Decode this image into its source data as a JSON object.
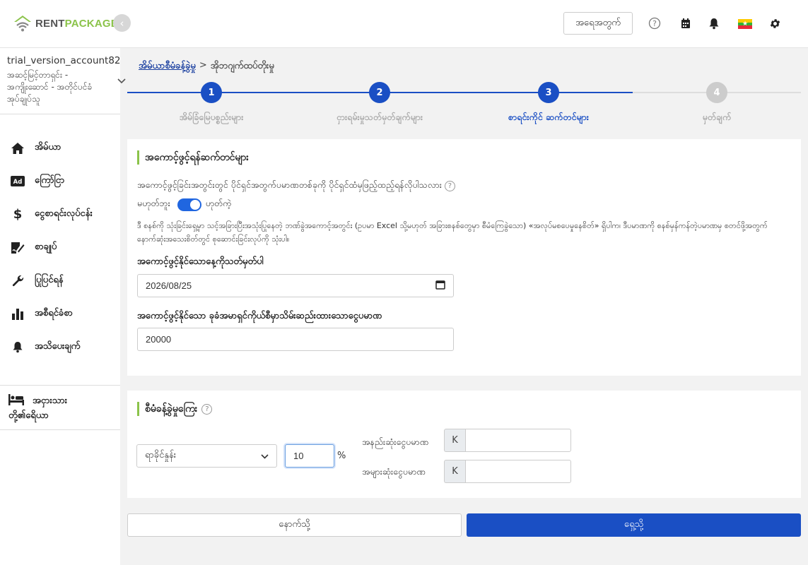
{
  "app": {
    "logo_rent": "RENT",
    "logo_package": "PACKAGE"
  },
  "header": {
    "search_label": "အရေအတွက်"
  },
  "account": {
    "name": "trial_version_account82",
    "plan": "အဆင့်မြင့်တာရှင်း - အကျိုးဆောင် - အတိုင်ပင်ခံ အုပ်ချုပ်သူ"
  },
  "sidebar": {
    "items": [
      {
        "label": "အိမ်ယာ",
        "icon": "home-icon"
      },
      {
        "label": "ကြော်ငြာ",
        "icon": "ad-icon"
      },
      {
        "label": "ငွေစာရင်းလုပ်ငန်း",
        "icon": "dollar-icon"
      },
      {
        "label": "စာချုပ်",
        "icon": "contract-icon"
      },
      {
        "label": "ပြုပြင်ရန်",
        "icon": "wrench-icon"
      },
      {
        "label": "အစီရင်ခံစာ",
        "icon": "bar-chart-icon"
      },
      {
        "label": "အသိပေးချက်",
        "icon": "bell-icon"
      }
    ],
    "footer_line1": "အငှားသား",
    "footer_line2": "တို့၏ရေိယာ"
  },
  "breadcrumb": {
    "home": "အိမ်ယာစီမံခန့်ခွဲမှု",
    "separator": ">",
    "current": "အိုဘဂျက်ထပ်တိုးမှု"
  },
  "stepper": {
    "steps": [
      {
        "number": "1",
        "label": "အိမ်ခြံမြေပစ္စည်းများ",
        "state": "done"
      },
      {
        "number": "2",
        "label": "ငှားရမ်းမှုသတ်မှတ်ချက်များ",
        "state": "done"
      },
      {
        "number": "3",
        "label": "စာရင်းကိုင် ဆက်တင်များ",
        "state": "active"
      },
      {
        "number": "4",
        "label": "မှတ်ချက်",
        "state": "pending"
      }
    ],
    "colors": {
      "active": "#1a4fc4",
      "done_label": "#aaaaaa",
      "pending": "#cccccc"
    }
  },
  "renewal": {
    "title": "အကောင့်ဖွင့်ရန်ဆက်တင်များ",
    "question": "အကောင့်ဖွင့်ခြင်းအတွင်းတွင် ပိုင်ရှင်အတွက်ပမာဏတစ်ခုကို ပိုင်ရှင်ထံမှဖြည့်ထည့်ရန်လိုပါသလား",
    "toggle_off": "မဟုတ်ဘူး",
    "toggle_on": "ဟုတ်ကဲ့",
    "toggle_state": "on",
    "note": "ဒီ စနစ်ကို သုံးခြင်းရှေ့မှာ သင့်အခြားပြီးအသုံးပြုနေတဲ့ ဘဏ်ခွဲအကောင့်အတွင်း (ဥပမာ Excel သို့မဟုတ် အခြားစနစ်တွေမှာ စီမံကြေခွဲသော) «အလုပ်မစပေမှုနေစိတ်» ရှိပါက၊ ဒီပမာဏကို စနစ်မှန်ကန်တဲ့ပမာဏမှ စတင်ဖို့အတွက် နောက်ဆုံးအသေးစိတ်တွင် စုဆောင်းခြင်းလုပ်ကို သုံးပါ။",
    "date_label": "အကောင့်ဖွင့်နိုင်သောနေ့ကိုသတ်မှတ်ပါ",
    "date_value": "2026/08/25",
    "amount_label": "အကောင့်ဖွင့်နိုင်သော ခုခံအမာရှင်ကိုယ်စီမှာသိမ်းဆည်းထားသောငွေပမာဏ",
    "amount_value": "20000"
  },
  "management": {
    "title": "စီမံခန့်ခွဲမှုကြေး",
    "select_value": "ရာခိုင်နှုန်း",
    "percent_value": "10",
    "percent_sign": "%",
    "min_label": "အနည်းဆုံးငွေပမာဏ",
    "max_label": "အများဆုံးငွေပမာဏ",
    "currency_prefix": "K"
  },
  "footer": {
    "back_label": "နောက်သို့",
    "next_label": "ရှေ့သို့"
  }
}
